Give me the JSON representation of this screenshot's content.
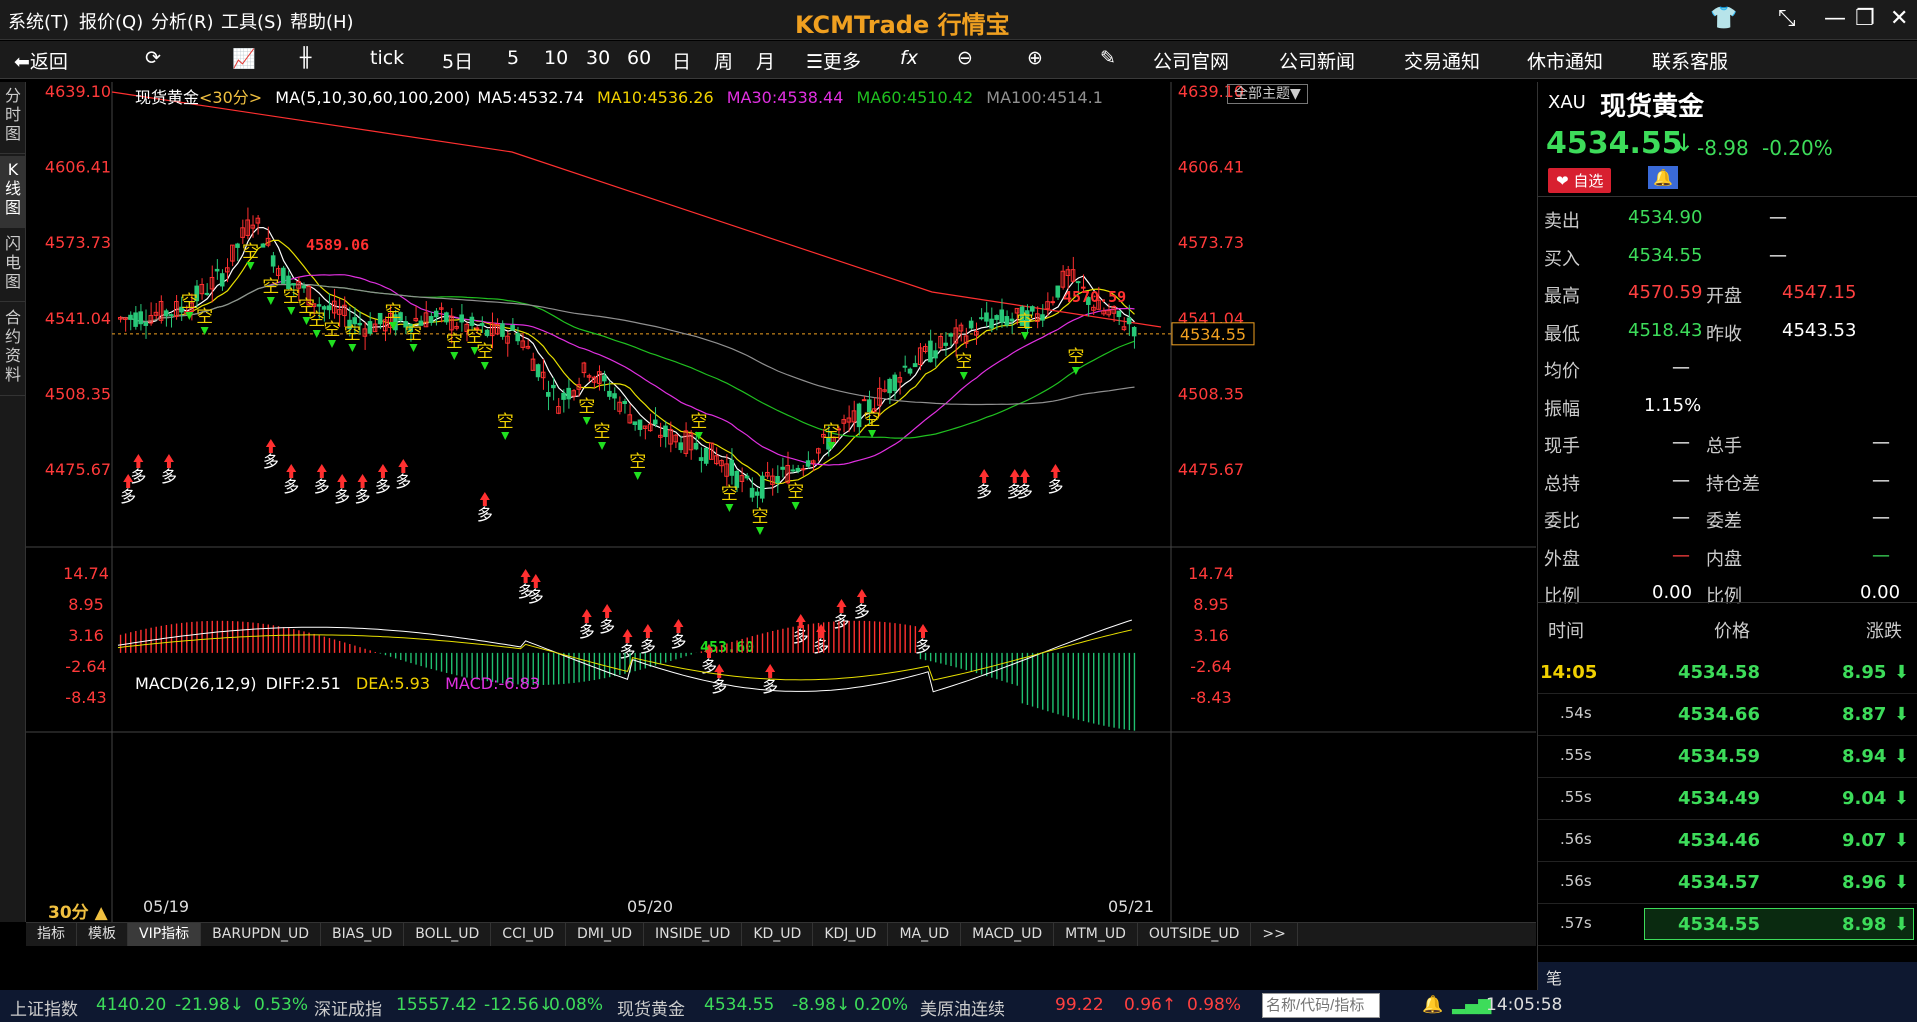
{
  "titlebar": {
    "menus": [
      "系统(T)",
      "报价(Q)",
      "分析(R)",
      "工具(S)",
      "帮助(H)"
    ],
    "brand": "KCMTrade 行情宝"
  },
  "toolbar": {
    "back": "返回",
    "tick": "tick",
    "items": [
      "5日",
      "5",
      "10",
      "30",
      "60",
      "日",
      "周",
      "月"
    ],
    "more": "更多",
    "links": [
      "公司官网",
      "公司新闻",
      "交易通知",
      "休市通知",
      "联系客服"
    ]
  },
  "sidetabs": [
    "分时图",
    "K线图",
    "闪电图",
    "合约资料"
  ],
  "chart": {
    "symbol": "现货黄金",
    "period_tag": "<30分>",
    "ma_label": "MA(5,10,30,60,100,200)",
    "ma5": "MA5:4532.74",
    "ma10": "MA10:4536.26",
    "ma30": "MA30:4538.44",
    "ma60": "MA60:4510.42",
    "ma100": "MA100:4514.1",
    "theme_btn": "全部主题▼",
    "price_ticks": [
      "4639.10",
      "4606.41",
      "4573.73",
      "4541.04",
      "4508.35",
      "4475.67"
    ],
    "last_price_tag": "4534.55",
    "high_mark": "4589.06",
    "high_mark2": "4570.59",
    "low_mark": "453.60",
    "macd_label": "MACD(26,12,9)",
    "diff": "DIFF:2.51",
    "dea": "DEA:5.93",
    "macd": "MACD:-6.83",
    "macd_ticks": [
      "14.74",
      "8.95",
      "3.16",
      "-2.64",
      "-8.43"
    ],
    "period": "30分 ▲",
    "dates": [
      "05/19",
      "05/20",
      "05/21"
    ],
    "signal_short": "空",
    "signal_long": "多",
    "colors": {
      "up": "#ff3030",
      "down": "#28c878",
      "ma5": "#ffffff",
      "ma10": "#e8e000",
      "ma30": "#e030e0",
      "ma60": "#20c020",
      "ma100": "#909090",
      "ma200": "#ff3030"
    }
  },
  "chart_data": {
    "type": "candlestick",
    "ylim": [
      4450,
      4650
    ],
    "current": 4534.55,
    "high": 4589.06,
    "low": 4453.6
  },
  "indicator_tabs": [
    "指标",
    "模板",
    "VIP指标",
    "BARUPDN_UD",
    "BIAS_UD",
    "BOLL_UD",
    "CCI_UD",
    "DMI_UD",
    "INSIDE_UD",
    "KD_UD",
    "KDJ_UD",
    "MA_UD",
    "MACD_UD",
    "MTM_UD",
    "OUTSIDE_UD",
    ">>"
  ],
  "quote": {
    "code": "XAU",
    "name": "现货黄金",
    "price": "4534.55",
    "arrow": "↓",
    "change": "-8.98",
    "pct": "-0.20%",
    "fav": "自选",
    "sell_lbl": "卖出",
    "sell": "4534.90",
    "buy_lbl": "买入",
    "buy": "4534.55",
    "dash": "—",
    "high_lbl": "最高",
    "high": "4570.59",
    "open_lbl": "开盘",
    "open": "4547.15",
    "low_lbl": "最低",
    "low": "4518.43",
    "prev_lbl": "昨收",
    "prev": "4543.53",
    "avg_lbl": "均价",
    "amp_lbl": "振幅",
    "amp": "1.15%",
    "cur_lbl": "现手",
    "tot_lbl": "总手",
    "hold_lbl": "总持",
    "holddiff_lbl": "持仓差",
    "wb_lbl": "委比",
    "wc_lbl": "委差",
    "out_lbl": "外盘",
    "in_lbl": "内盘",
    "ratio_lbl": "比例",
    "ratio1": "0.00",
    "ratio2": "0.00",
    "th_time": "时间",
    "th_price": "价格",
    "th_chg": "涨跌",
    "ticks": [
      {
        "t": "14:05",
        "p": "4534.58",
        "c": "8.95"
      },
      {
        "t": ".54s",
        "p": "4534.66",
        "c": "8.87"
      },
      {
        "t": ".55s",
        "p": "4534.59",
        "c": "8.94"
      },
      {
        "t": ".55s",
        "p": "4534.49",
        "c": "9.04"
      },
      {
        "t": ".56s",
        "p": "4534.46",
        "c": "9.07"
      },
      {
        "t": ".56s",
        "p": "4534.57",
        "c": "8.96"
      },
      {
        "t": ".57s",
        "p": "4534.55",
        "c": "8.98"
      }
    ],
    "bi": "笔",
    "search_placeholder": "名称/代码/指标"
  },
  "status": {
    "n1": "上证指数",
    "v1": "4140.20",
    "c1": "-21.98↓",
    "p1": "0.53%",
    "n2": "深证成指",
    "v2": "15557.42",
    "c2": "-12.56↓",
    "p2": "0.08%",
    "n3": "现货黄金",
    "v3": "4534.55",
    "c3": "-8.98↓",
    "p3": "0.20%",
    "n4": "美原油连续",
    "v4": "99.22",
    "c4": "0.96↑",
    "p4": "0.98%",
    "time": "14:05:58"
  }
}
